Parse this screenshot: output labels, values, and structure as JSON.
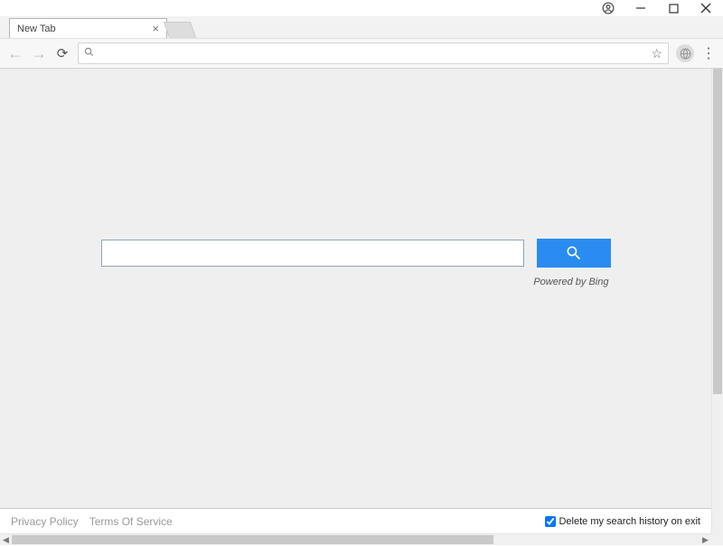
{
  "window": {
    "tab_title": "New Tab"
  },
  "address_bar": {
    "value": ""
  },
  "search": {
    "value": "",
    "powered_by": "Powered by Bing"
  },
  "footer": {
    "privacy": "Privacy Policy",
    "terms": "Terms Of Service",
    "delete_history": "Delete my search history on exit",
    "delete_checked": true
  }
}
